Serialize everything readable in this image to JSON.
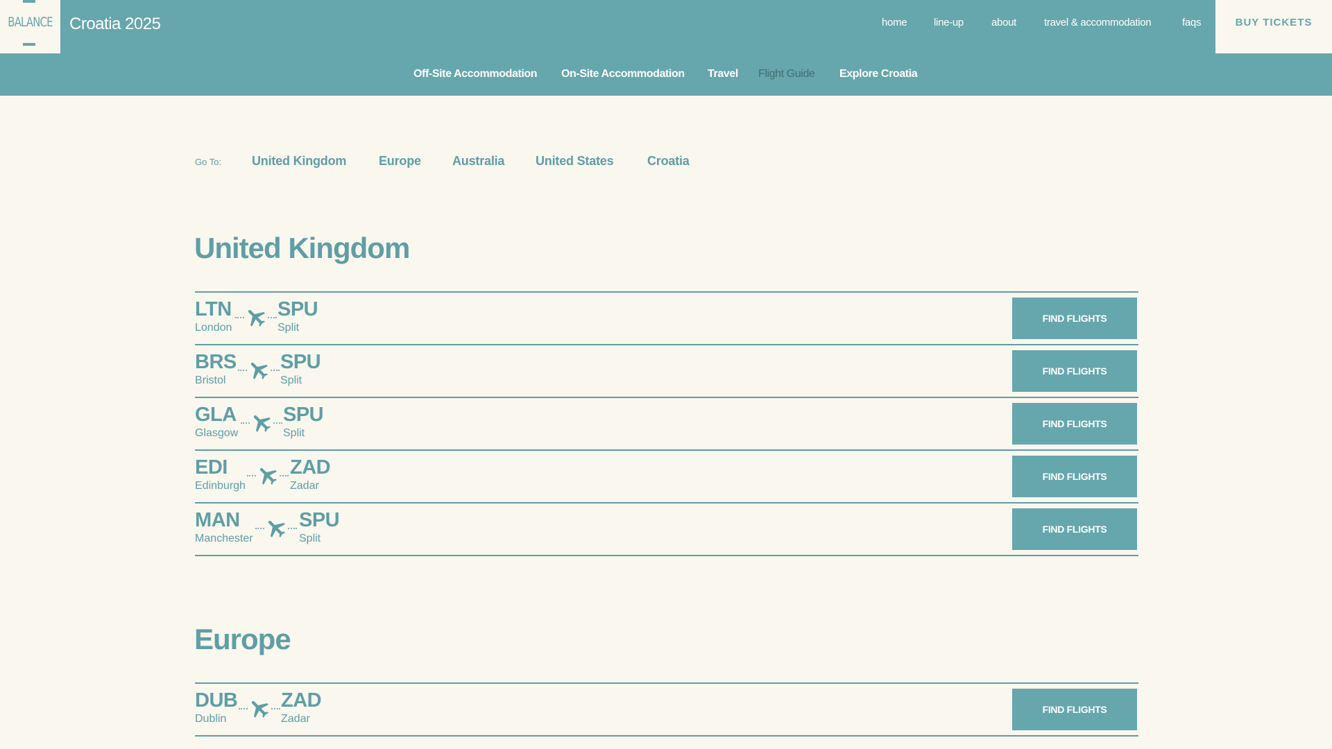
{
  "header": {
    "logo_text": "BALANCE",
    "site_title": "Croatia 2025",
    "nav": [
      "home",
      "line-up",
      "about",
      "travel & accommodation",
      "faqs"
    ],
    "buy_label": "BUY TICKETS"
  },
  "subnav": {
    "items": [
      "Off-Site Accommodation",
      "On-Site Accommodation",
      "Travel",
      "Flight Guide",
      "Explore Croatia"
    ],
    "active": "Flight Guide"
  },
  "goto": {
    "label": "Go To:",
    "links": [
      "United Kingdom",
      "Europe",
      "Australia",
      "United States",
      "Croatia"
    ]
  },
  "sections": [
    {
      "title": "United Kingdom",
      "routes": [
        {
          "from_code": "LTN",
          "from_city": "London",
          "to_code": "SPU",
          "to_city": "Split",
          "button": "FIND FLIGHTS"
        },
        {
          "from_code": "BRS",
          "from_city": "Bristol",
          "to_code": "SPU",
          "to_city": "Split",
          "button": "FIND FLIGHTS"
        },
        {
          "from_code": "GLA",
          "from_city": "Glasgow",
          "to_code": "SPU",
          "to_city": "Split",
          "button": "FIND FLIGHTS"
        },
        {
          "from_code": "EDI",
          "from_city": "Edinburgh",
          "to_code": "ZAD",
          "to_city": "Zadar",
          "button": "FIND FLIGHTS"
        },
        {
          "from_code": "MAN",
          "from_city": "Manchester",
          "to_code": "SPU",
          "to_city": "Split",
          "button": "FIND FLIGHTS"
        }
      ]
    },
    {
      "title": "Europe",
      "routes": [
        {
          "from_code": "DUB",
          "from_city": "Dublin",
          "to_code": "ZAD",
          "to_city": "Zadar",
          "button": "FIND FLIGHTS"
        }
      ]
    }
  ],
  "icons": {
    "plane": "airplane-icon"
  },
  "colors": {
    "accent": "#66a6ad",
    "background": "#f9f7ee",
    "text": "#5f9ea5",
    "active_sub": "#3f6f74"
  }
}
